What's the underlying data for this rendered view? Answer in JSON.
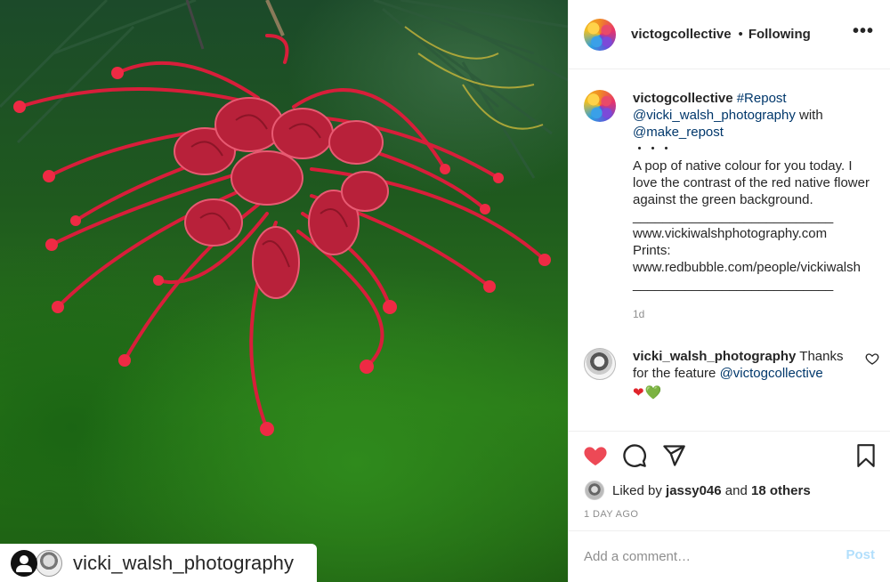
{
  "photo": {
    "repost_username": "vicki_walsh_photography"
  },
  "header": {
    "username": "victogcollective",
    "separator": "•",
    "follow_status": "Following",
    "more_label": "•••"
  },
  "caption": {
    "username": "victogcollective",
    "repost_tag": "#Repost",
    "mention_author": "@vicki_walsh_photography",
    "with_word": "with",
    "mention_tool": "@make_repost",
    "dots": "・・・",
    "text": "A pop of native colour for you today. I love the contrast of the red native flower against the green background.",
    "divider_1": "___________________________",
    "website": "www.vickiwalshphotography.com",
    "prints_label": "Prints:",
    "prints_url": "www.redbubble.com/people/vickiwalsh",
    "divider_2": "___________________________",
    "age": "1d"
  },
  "comment": {
    "username": "vicki_walsh_photography",
    "text": "Thanks for the feature",
    "mention": "@victogcollective",
    "emoji_1": "❤",
    "emoji_2": "💚"
  },
  "likes": {
    "prefix": "Liked by",
    "user": "jassy046",
    "and": "and",
    "others": "18 others"
  },
  "timestamp": "1 DAY AGO",
  "add_comment": {
    "placeholder": "Add a comment…",
    "post_label": "Post"
  },
  "colors": {
    "like_active": "#ed4956",
    "link": "#00376b",
    "post_disabled": "#b2dffc"
  }
}
